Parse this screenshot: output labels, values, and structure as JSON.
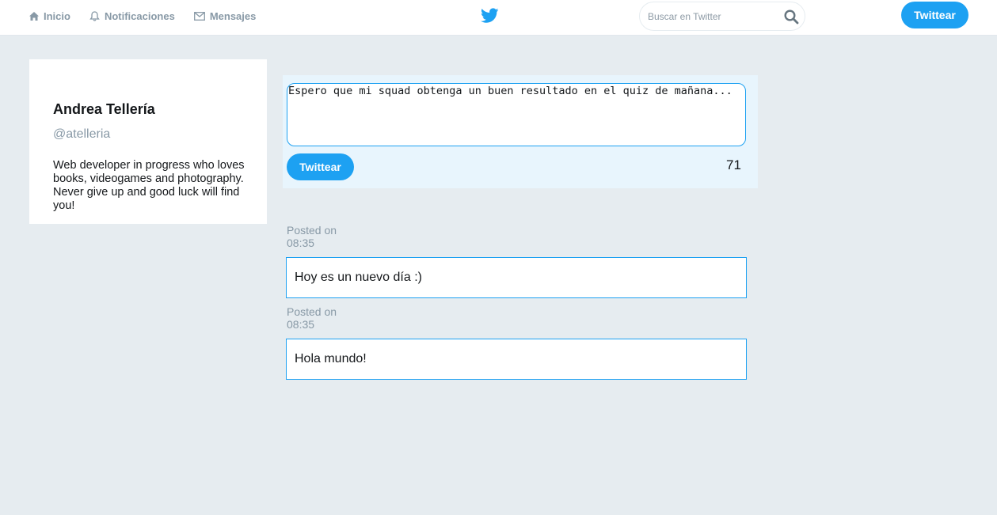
{
  "nav": {
    "items": [
      {
        "label": "Inicio",
        "icon": "home-icon"
      },
      {
        "label": "Notificaciones",
        "icon": "bell-icon"
      },
      {
        "label": "Mensajes",
        "icon": "envelope-icon"
      }
    ],
    "logo_icon": "twitter-bird-icon",
    "search_placeholder": "Buscar en Twitter",
    "tweet_button": "Twittear"
  },
  "profile": {
    "name": "Andrea Tellería",
    "handle": "@atelleria",
    "bio": "Web developer in progress who loves books, videogames and photography. Never give up and good luck will find you!"
  },
  "composer": {
    "text": "Espero que mi squad obtenga un buen resultado en el quiz de mañana...",
    "button": "Twittear",
    "remaining_chars": "71"
  },
  "posts": [
    {
      "posted_label": "Posted on",
      "time": "08:35",
      "text": "Hoy es un nuevo día :)"
    },
    {
      "posted_label": "Posted on",
      "time": "08:35",
      "text": "Hola mundo!"
    }
  ],
  "colors": {
    "accent": "#1da1f2",
    "background": "#e6ecf0",
    "muted": "#8899a6",
    "composer_bg": "#e8f5fd"
  }
}
